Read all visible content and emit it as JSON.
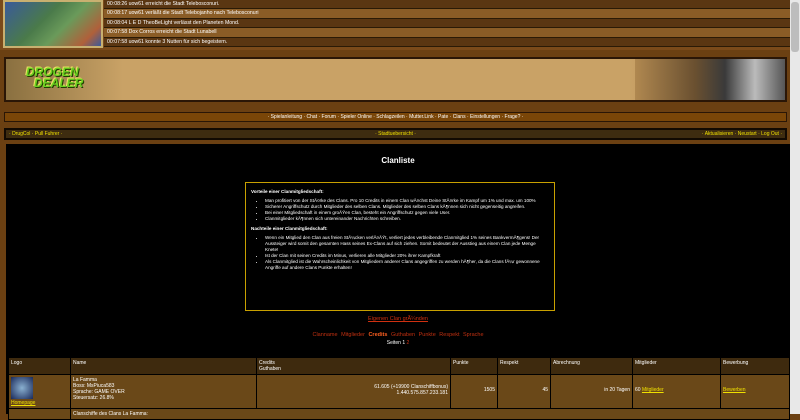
{
  "log": [
    "00:08:26 uow61 erreicht die Stadt Telebosconuri.",
    "00:08:17 uow61 verläßt die Stadt Telebojanho nach Telebosconuri",
    "00:08:04 L E D TheoBeLight verlässt den Planeten Mond.",
    "00:07:58 Dox Corros erreicht die Stadt Lunabell",
    "00:07:58 uow61 konnte 3 Nutten für sich begeistern."
  ],
  "banner": {
    "logo_line1": "DROGEN",
    "logo_line2": "DEALER"
  },
  "nav": [
    "Spielanleitung",
    "Chat",
    "Forum",
    "Spieler Online",
    "Schlagzeilen",
    "Mutter.Link",
    "Pate",
    "Clans",
    "Einstellungen",
    "Frage?"
  ],
  "subnav": {
    "left": [
      "DrugCol",
      "Pull Fuhrer"
    ],
    "center": "Stadtuebersicht",
    "right": [
      "Aktualisieren",
      "Neustart",
      "Log Out"
    ]
  },
  "title": "Clanliste",
  "info": {
    "pro_title": "Vorteile einer Clanmitgliedschaft:",
    "pros": [
      "Man profitiert von der StÃ¤rke des Clans. Pro 10 Credits in einem Clan wÃ¤chst Deine StÃ¤rke im Kampf um 1% und max. um 100%",
      "Sicherer Angriffschutz durch Mitglieder des selben Clans. Mitglieder des selben Clans kÃ¶nnen sich nicht gegenseitig angreifen.",
      "Bei einer Mitgliedschaft in einem groÃŸen Clan, besteht ein Angriffschutz gegen viele User.",
      "Clanmitglieder kÃ¶nnen sich untereinander Nachrichten schreiben."
    ],
    "con_title": "Nachteile einer Clanmitgliedschaft:",
    "cons": [
      "Wenn ein Mitglied den Clan aus freien StÃ¼cken verlÃ¤ÃŸt, verliert jedes verbleibende Clanmitglied 1% seines BankvermÃ¶gens! Der Aussteiger wird somit den gesamten Hass seines Ex-Clans auf sich ziehen. Somit bedeutet der Ausstieg aus einem Clan jede Menge Knete!",
      "Ist der Clan mit seinen Credits im Minus, verlieren alle Mitglieder 20% ihrer Kampfkraft",
      "Als Clanmitglied ist die Wahrscheinlichkeit von Mitgliedern anderer Clans angegriffen zu werden hÃ¶her, da die Clans fÃ¼r gewonnene Angriffe auf andere Clans Punkte erhalten!"
    ]
  },
  "create_link": "Eigenen Clan grÃ¼nden",
  "sort": [
    "Clanname",
    "Mitglieder",
    "Credits",
    "Guthaben",
    "Punkte",
    "Respekt",
    "Sprache"
  ],
  "pages": {
    "label": "Seiten",
    "current": "1",
    "other": "2"
  },
  "table": {
    "headers": [
      "Logo",
      "Name",
      "Credits",
      "Guthaben",
      "Punkte",
      "Respekt",
      "Abrechnung",
      "Mitglieder",
      "Bewerbung"
    ],
    "row": {
      "homepage": "Homepage",
      "name": "La Famma",
      "boss": "Boss: MsPiuca583",
      "lang": "Sprache: GAME OVER",
      "tax": "Steuersatz: 26.8%",
      "credits": "61.605 (+19900 Clanschiffbonus)",
      "guthaben": "1.440.575.857.233.181",
      "punkte": "1505",
      "respekt": "45",
      "abrechnung": "in 20 Tagen",
      "members_count": "60",
      "members_link": "Mitglieder",
      "apply": "Bewerben"
    },
    "ships": "Clanschiffe des Clans La Famma:"
  }
}
